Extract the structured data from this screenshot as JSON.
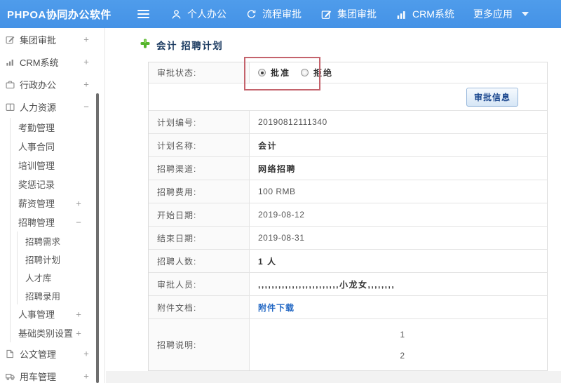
{
  "colors": {
    "header_blue": "#4796e8",
    "title_navy": "#17375e",
    "plus_green": "#55b42d",
    "link_blue": "#2368c4",
    "annotation_red": "#c4636c"
  },
  "header": {
    "logo": "PHPOA协同办公软件",
    "nav": [
      {
        "label": "个人办公",
        "icon": "person-icon"
      },
      {
        "label": "流程审批",
        "icon": "flow-icon"
      },
      {
        "label": "集团审批",
        "icon": "edit-icon"
      },
      {
        "label": "CRM系统",
        "icon": "chart-icon"
      },
      {
        "label": "更多应用",
        "icon": "caret-down-icon"
      }
    ]
  },
  "sidebar": {
    "items": [
      {
        "label": "集团审批",
        "icon": "edit-icon",
        "expander": "+"
      },
      {
        "label": "CRM系统",
        "icon": "chart-icon",
        "expander": "+"
      },
      {
        "label": "行政办公",
        "icon": "briefcase-icon",
        "expander": "+"
      },
      {
        "label": "人力资源",
        "icon": "book-icon",
        "expander": "−"
      },
      {
        "label": "公文管理",
        "icon": "doc-icon",
        "expander": "+"
      },
      {
        "label": "用车管理",
        "icon": "truck-icon",
        "expander": "+"
      }
    ],
    "hr_children": [
      {
        "label": "考勤管理"
      },
      {
        "label": "人事合同"
      },
      {
        "label": "培训管理"
      },
      {
        "label": "奖惩记录"
      },
      {
        "label": "薪资管理",
        "expander": "+"
      },
      {
        "label": "招聘管理",
        "expander": "−"
      },
      {
        "label": "人事管理",
        "expander": "+"
      },
      {
        "label": "基础类别设置",
        "expander": "+"
      }
    ],
    "recruit_children": [
      {
        "label": "招聘需求"
      },
      {
        "label": "招聘计划"
      },
      {
        "label": "人才库"
      },
      {
        "label": "招聘录用"
      }
    ]
  },
  "main": {
    "title": "会计 招聘计划",
    "status_row": {
      "label": "审批状态:",
      "options": [
        {
          "label": "批准",
          "selected": true
        },
        {
          "label": "拒绝",
          "selected": false
        }
      ]
    },
    "approve_button": "审批信息",
    "rows": [
      {
        "label": "计划编号:",
        "value": "20190812111340"
      },
      {
        "label": "计划名称:",
        "value": "会计"
      },
      {
        "label": "招聘渠道:",
        "value": "网络招聘"
      },
      {
        "label": "招聘费用:",
        "value": "100 RMB"
      },
      {
        "label": "开始日期:",
        "value": "2019-08-12"
      },
      {
        "label": "结束日期:",
        "value": "2019-08-31"
      },
      {
        "label": "招聘人数:",
        "value": "1 人"
      },
      {
        "label": "审批人员:",
        "value": ",,,,,,,,,,,,,,,,,,,,,,,,小龙女,,,,,,,,"
      },
      {
        "label": "附件文档:",
        "value": "附件下载"
      },
      {
        "label": "招聘说明:",
        "lines": [
          "1",
          "2"
        ]
      }
    ]
  }
}
